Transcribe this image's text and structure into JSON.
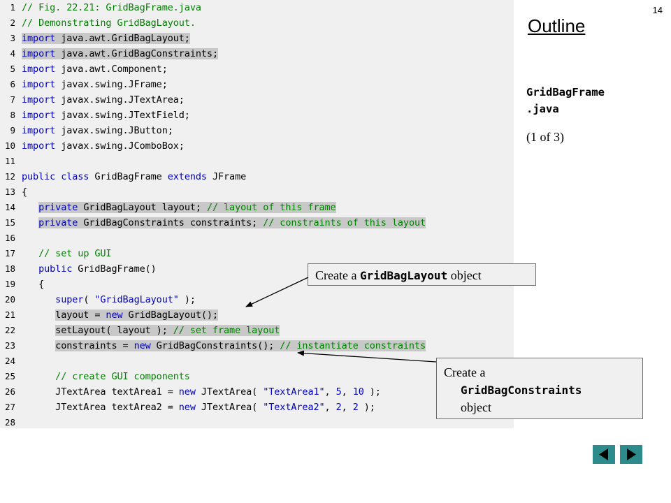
{
  "slide_number": "14",
  "outline": {
    "title": "Outline",
    "file_label": "GridBagFrame\n.java",
    "page_info": "(1 of 3)"
  },
  "code_lines": [
    {
      "n": "1",
      "highlight": false,
      "parts": [
        {
          "t": "comment",
          "s": "// Fig. 22.21: GridBagFrame.java"
        }
      ]
    },
    {
      "n": "2",
      "highlight": false,
      "parts": [
        {
          "t": "comment",
          "s": "// Demonstrating GridBagLayout."
        }
      ]
    },
    {
      "n": "3",
      "highlight": true,
      "parts": [
        {
          "t": "kw",
          "s": "import"
        },
        {
          "t": "plain",
          "s": " java.awt.GridBagLayout;"
        }
      ]
    },
    {
      "n": "4",
      "highlight": true,
      "parts": [
        {
          "t": "kw",
          "s": "import"
        },
        {
          "t": "plain",
          "s": " java.awt.GridBagConstraints;"
        }
      ]
    },
    {
      "n": "5",
      "highlight": false,
      "parts": [
        {
          "t": "kw",
          "s": "import"
        },
        {
          "t": "plain",
          "s": " java.awt.Component;"
        }
      ]
    },
    {
      "n": "6",
      "highlight": false,
      "parts": [
        {
          "t": "kw",
          "s": "import"
        },
        {
          "t": "plain",
          "s": " javax.swing.JFrame;"
        }
      ]
    },
    {
      "n": "7",
      "highlight": false,
      "parts": [
        {
          "t": "kw",
          "s": "import"
        },
        {
          "t": "plain",
          "s": " javax.swing.JTextArea;"
        }
      ]
    },
    {
      "n": "8",
      "highlight": false,
      "parts": [
        {
          "t": "kw",
          "s": "import"
        },
        {
          "t": "plain",
          "s": " javax.swing.JTextField;"
        }
      ]
    },
    {
      "n": "9",
      "highlight": false,
      "parts": [
        {
          "t": "kw",
          "s": "import"
        },
        {
          "t": "plain",
          "s": " javax.swing.JButton;"
        }
      ]
    },
    {
      "n": "10",
      "highlight": false,
      "parts": [
        {
          "t": "kw",
          "s": "import"
        },
        {
          "t": "plain",
          "s": " javax.swing.JComboBox;"
        }
      ]
    },
    {
      "n": "11",
      "highlight": false,
      "parts": []
    },
    {
      "n": "12",
      "highlight": false,
      "parts": [
        {
          "t": "kw",
          "s": "public class"
        },
        {
          "t": "plain",
          "s": " GridBagFrame "
        },
        {
          "t": "kw",
          "s": "extends"
        },
        {
          "t": "plain",
          "s": " JFrame"
        }
      ]
    },
    {
      "n": "13",
      "highlight": false,
      "parts": [
        {
          "t": "plain",
          "s": "{"
        }
      ]
    },
    {
      "n": "14",
      "highlight": true,
      "indent": "   ",
      "parts": [
        {
          "t": "kw",
          "s": "private"
        },
        {
          "t": "plain",
          "s": " GridBagLayout layout; "
        },
        {
          "t": "comment",
          "s": "// layout of this frame"
        }
      ]
    },
    {
      "n": "15",
      "highlight": true,
      "indent": "   ",
      "parts": [
        {
          "t": "kw",
          "s": "private"
        },
        {
          "t": "plain",
          "s": " GridBagConstraints constraints; "
        },
        {
          "t": "comment",
          "s": "// constraints of this layout"
        }
      ]
    },
    {
      "n": "16",
      "highlight": false,
      "parts": []
    },
    {
      "n": "17",
      "highlight": false,
      "indent": "   ",
      "parts": [
        {
          "t": "comment",
          "s": "// set up GUI"
        }
      ]
    },
    {
      "n": "18",
      "highlight": false,
      "indent": "   ",
      "parts": [
        {
          "t": "kw",
          "s": "public"
        },
        {
          "t": "plain",
          "s": " GridBagFrame()"
        }
      ]
    },
    {
      "n": "19",
      "highlight": false,
      "indent": "   ",
      "parts": [
        {
          "t": "plain",
          "s": "{"
        }
      ]
    },
    {
      "n": "20",
      "highlight": false,
      "indent": "      ",
      "parts": [
        {
          "t": "kw",
          "s": "super"
        },
        {
          "t": "plain",
          "s": "( "
        },
        {
          "t": "str",
          "s": "\"GridBagLayout\""
        },
        {
          "t": "plain",
          "s": " );"
        }
      ]
    },
    {
      "n": "21",
      "highlight": true,
      "indent": "      ",
      "parts": [
        {
          "t": "plain",
          "s": "layout = "
        },
        {
          "t": "kw",
          "s": "new"
        },
        {
          "t": "plain",
          "s": " GridBagLayout();"
        }
      ]
    },
    {
      "n": "22",
      "highlight": true,
      "indent": "      ",
      "parts": [
        {
          "t": "plain",
          "s": "setLayout( layout ); "
        },
        {
          "t": "comment",
          "s": "// set frame layout"
        }
      ]
    },
    {
      "n": "23",
      "highlight": true,
      "indent": "      ",
      "parts": [
        {
          "t": "plain",
          "s": "constraints = "
        },
        {
          "t": "kw",
          "s": "new"
        },
        {
          "t": "plain",
          "s": " GridBagConstraints(); "
        },
        {
          "t": "comment",
          "s": "// instantiate constraints"
        }
      ]
    },
    {
      "n": "24",
      "highlight": false,
      "parts": []
    },
    {
      "n": "25",
      "highlight": false,
      "indent": "      ",
      "parts": [
        {
          "t": "comment",
          "s": "// create GUI components"
        }
      ]
    },
    {
      "n": "26",
      "highlight": false,
      "indent": "      ",
      "parts": [
        {
          "t": "plain",
          "s": "JTextArea textArea1 = "
        },
        {
          "t": "kw",
          "s": "new"
        },
        {
          "t": "plain",
          "s": " JTextArea( "
        },
        {
          "t": "str",
          "s": "\"TextArea1\""
        },
        {
          "t": "plain",
          "s": ", "
        },
        {
          "t": "str",
          "s": "5"
        },
        {
          "t": "plain",
          "s": ", "
        },
        {
          "t": "str",
          "s": "10"
        },
        {
          "t": "plain",
          "s": " );"
        }
      ]
    },
    {
      "n": "27",
      "highlight": false,
      "indent": "      ",
      "parts": [
        {
          "t": "plain",
          "s": "JTextArea textArea2 = "
        },
        {
          "t": "kw",
          "s": "new"
        },
        {
          "t": "plain",
          "s": " JTextArea( "
        },
        {
          "t": "str",
          "s": "\"TextArea2\""
        },
        {
          "t": "plain",
          "s": ", "
        },
        {
          "t": "str",
          "s": "2"
        },
        {
          "t": "plain",
          "s": ", "
        },
        {
          "t": "str",
          "s": "2"
        },
        {
          "t": "plain",
          "s": " );"
        }
      ]
    },
    {
      "n": "28",
      "highlight": false,
      "parts": []
    }
  ],
  "callouts": {
    "layout": {
      "pre": "Create a ",
      "code": "GridBagLayout",
      "post": " object"
    },
    "constraints": {
      "pre": "Create a",
      "code": "GridBagConstraints",
      "post": "object"
    }
  },
  "nav": {
    "prev_icon": "triangle-left-icon",
    "next_icon": "triangle-right-icon"
  },
  "colors": {
    "comment": "#008000",
    "keyword": "#0000c0",
    "highlight": "#c8c8c8",
    "panel": "#f0f0f0",
    "nav": "#2e8b8b"
  }
}
